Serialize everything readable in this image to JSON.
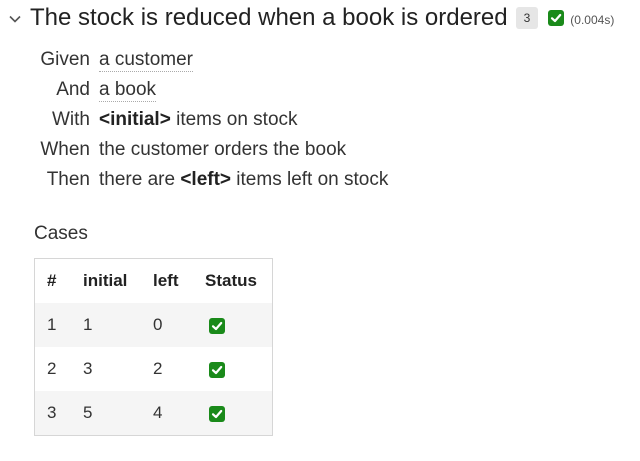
{
  "scenario": {
    "title": "The stock is reduced when a book is ordered",
    "case_count": "3",
    "duration": "(0.004s)"
  },
  "steps": [
    {
      "keyword": "Given",
      "parts": [
        {
          "text": "a customer",
          "type": "link"
        }
      ]
    },
    {
      "keyword": "And",
      "parts": [
        {
          "text": "a book",
          "type": "link"
        }
      ]
    },
    {
      "keyword": "With",
      "parts": [
        {
          "text": "<initial>",
          "type": "param"
        },
        {
          "text": " items on stock",
          "type": "text"
        }
      ]
    },
    {
      "keyword": "When",
      "parts": [
        {
          "text": "the customer orders the book",
          "type": "text"
        }
      ]
    },
    {
      "keyword": "Then",
      "parts": [
        {
          "text": "there are ",
          "type": "text"
        },
        {
          "text": "<left>",
          "type": "param"
        },
        {
          "text": " items left on stock",
          "type": "text"
        }
      ]
    }
  ],
  "cases": {
    "title": "Cases",
    "headers": [
      "#",
      "initial",
      "left",
      "Status"
    ],
    "rows": [
      {
        "num": "1",
        "initial": "1",
        "left": "0",
        "status": "passed"
      },
      {
        "num": "2",
        "initial": "3",
        "left": "2",
        "status": "passed"
      },
      {
        "num": "3",
        "initial": "5",
        "left": "4",
        "status": "passed"
      }
    ]
  },
  "icons": {
    "expand": "chevron-down-icon",
    "status": "check-square-icon"
  },
  "colors": {
    "passed": "#1a8a1a",
    "badge_bg": "#e6e6e6"
  }
}
